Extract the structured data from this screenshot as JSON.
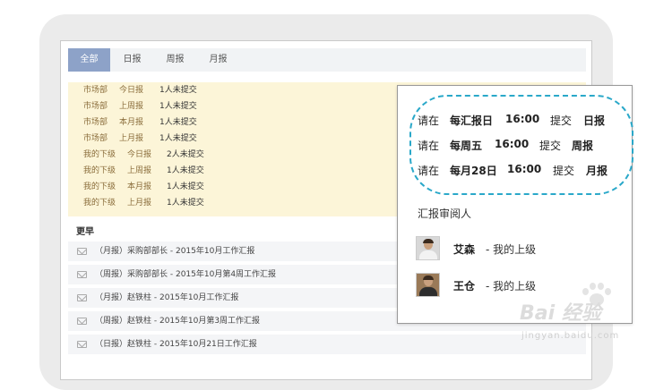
{
  "tabs": [
    {
      "label": "全部",
      "active": true
    },
    {
      "label": "日报",
      "active": false
    },
    {
      "label": "周报",
      "active": false
    },
    {
      "label": "月报",
      "active": false
    }
  ],
  "pending": [
    {
      "dept": "市场部",
      "period": "今日报",
      "count": "1人未提交"
    },
    {
      "dept": "市场部",
      "period": "上周报",
      "count": "1人未提交"
    },
    {
      "dept": "市场部",
      "period": "本月报",
      "count": "1人未提交"
    },
    {
      "dept": "市场部",
      "period": "上月报",
      "count": "1人未提交"
    },
    {
      "dept": "我的下级",
      "period": "今日报",
      "count": "2人未提交"
    },
    {
      "dept": "我的下级",
      "period": "上周报",
      "count": "1人未提交"
    },
    {
      "dept": "我的下级",
      "period": "本月报",
      "count": "1人未提交"
    },
    {
      "dept": "我的下级",
      "period": "上月报",
      "count": "1人未提交"
    }
  ],
  "section_title": "更早",
  "reports": [
    "（月报）采购部部长 - 2015年10月工作汇报",
    "（周报）采购部部长 - 2015年10月第4周工作汇报",
    "（月报）赵铁柱 - 2015年10月工作汇报",
    "（周报）赵铁柱 - 2015年10月第3周工作汇报",
    "（日报）赵铁柱 - 2015年10月21日工作汇报"
  ],
  "popup": {
    "rules": [
      {
        "prefix": "请在",
        "day": "每汇报日",
        "time": "16:00",
        "action": "提交",
        "type": "日报"
      },
      {
        "prefix": "请在",
        "day": "每周五",
        "time": "16:00",
        "action": "提交",
        "type": "周报"
      },
      {
        "prefix": "请在",
        "day": "每月28日",
        "time": "16:00",
        "action": "提交",
        "type": "月报"
      }
    ],
    "reviewer_title": "汇报审阅人",
    "reviewers": [
      {
        "name": "艾森",
        "relation": "- 我的上级"
      },
      {
        "name": "王仓",
        "relation": "- 我的上级"
      }
    ]
  },
  "watermark": {
    "brand": "Bai 经验",
    "url": "jingyan.baidu.com"
  },
  "colors": {
    "accent": "#2aa8c9",
    "tab_active": "#8da2c8",
    "pending_bg": "#fcf5d8"
  }
}
